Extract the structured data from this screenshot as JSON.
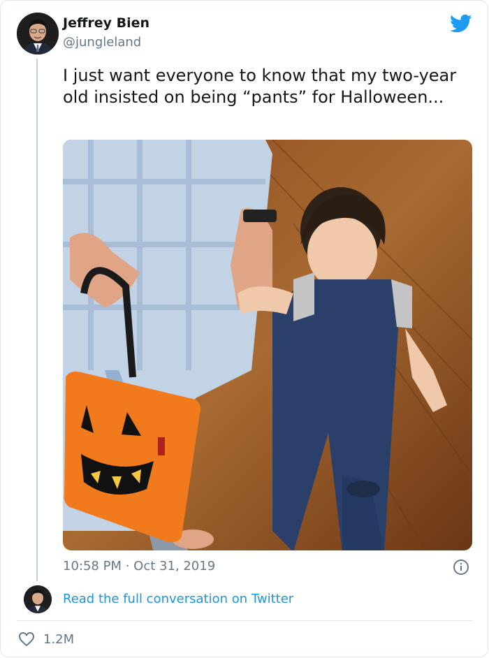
{
  "author": {
    "name": "Jeffrey Bien",
    "handle": "@jungleland"
  },
  "tweet": {
    "text": "I just want everyone to know that my two-year old insisted on being “pants” for Halloween...",
    "timestamp": "10:58 PM · Oct 31, 2019"
  },
  "footer": {
    "read_link": "Read the full conversation on Twitter",
    "like_count": "1.2M"
  },
  "icons": {
    "brand": "twitter-bird-icon",
    "info": "info-icon",
    "like": "heart-icon"
  },
  "colors": {
    "brand_blue": "#1d9bf0",
    "link_blue": "#1b95e0",
    "muted_text": "#657786",
    "border": "#e1e8ed"
  }
}
